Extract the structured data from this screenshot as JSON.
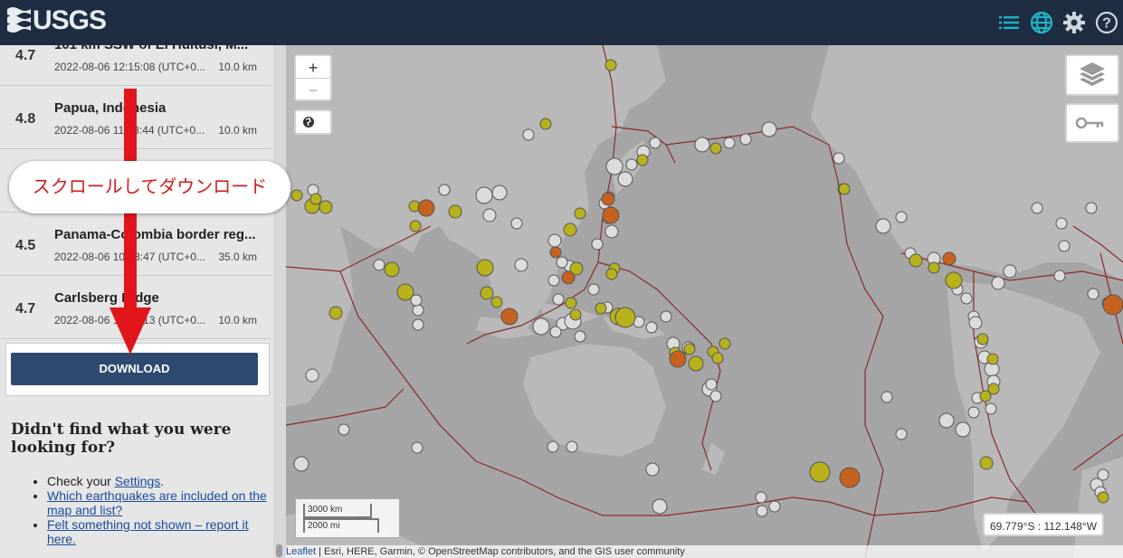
{
  "header": {
    "logo_text": "USGS",
    "icons": [
      "list-icon",
      "globe-icon",
      "gear-icon",
      "help-icon"
    ],
    "accent_color": "#1fb3c6",
    "bg_color": "#1f2d42"
  },
  "quakes": [
    {
      "mag": "4.7",
      "title": "101 km SSW of El Hultusi, M...",
      "time": "2022-08-06 12:15:08 (UTC+0...",
      "depth": "10.0 km"
    },
    {
      "mag": "4.8",
      "title": "Papua, Indonesia",
      "time": "2022-08-06 11:48:44 (UTC+0...",
      "depth": "10.0 km"
    },
    {
      "mag": "4.5",
      "title": "Panama-Colombia border reg...",
      "time": "2022-08-06 10:53:47 (UTC+0...",
      "depth": "35.0 km"
    },
    {
      "mag": "4.7",
      "title": "Carlsberg Ridge",
      "time": "2022-08-06 10:13:13 (UTC+0...",
      "depth": "10.0 km"
    }
  ],
  "download": {
    "label": "DOWNLOAD"
  },
  "help": {
    "title": "Didn't find what you were looking for?",
    "check_prefix": "Check your ",
    "settings_link": "Settings",
    "check_suffix": ".",
    "link_included": "Which earthquakes are included on the map and list?",
    "link_felt": "Felt something not shown – report it here."
  },
  "map": {
    "zoom_in": "+",
    "zoom_out": "−",
    "scale_km": "3000 km",
    "scale_mi": "2000 mi",
    "coords": "69.779°S : 112.148°W",
    "attribution_link": "Leaflet",
    "attribution_text": " | Esri, HERE, Garmin, © OpenStreetMap contributors, and the GIS user community"
  },
  "annotation": {
    "callout_text": "スクロールしてダウンロード",
    "color": "#e0161b"
  }
}
